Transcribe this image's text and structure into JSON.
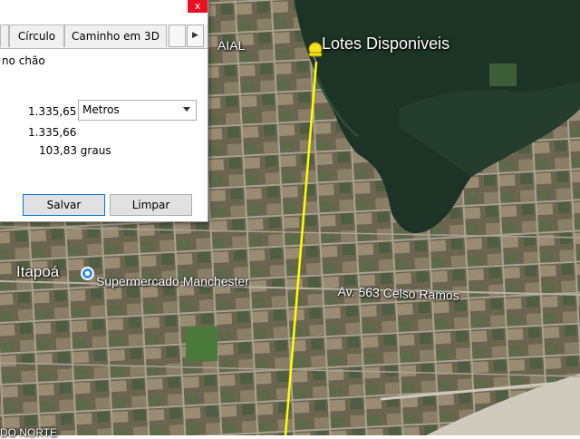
{
  "colors": {
    "measure_line": "#ffff00",
    "close_button": "#e81123",
    "vegetation": "#1c3325",
    "urban": "#6f6a56"
  },
  "dialog": {
    "close_label": "x",
    "tabs": [
      "Círculo",
      "Caminho em 3D"
    ],
    "tab_scroll_right": "▶",
    "ground_text": "no chão",
    "length_value": "1.335,65",
    "unit_selected": "Metros",
    "ground_length_value": "1.335,66",
    "heading_value": "103,83 graus",
    "save_button": "Salvar",
    "clear_button": "Limpar"
  },
  "map": {
    "pin_label": "Lotes  Disponiveis",
    "pin_icon": "yellow-pushpin-icon",
    "partial_label_top": "AIAL",
    "city_label": "Itapoá",
    "poi_label": "Supermercado Manchester",
    "poi_icon": "shopping-pin-icon",
    "street_label": "Av. 563 Celso Ramos",
    "partial_label_bottom": "DO NORTE"
  }
}
